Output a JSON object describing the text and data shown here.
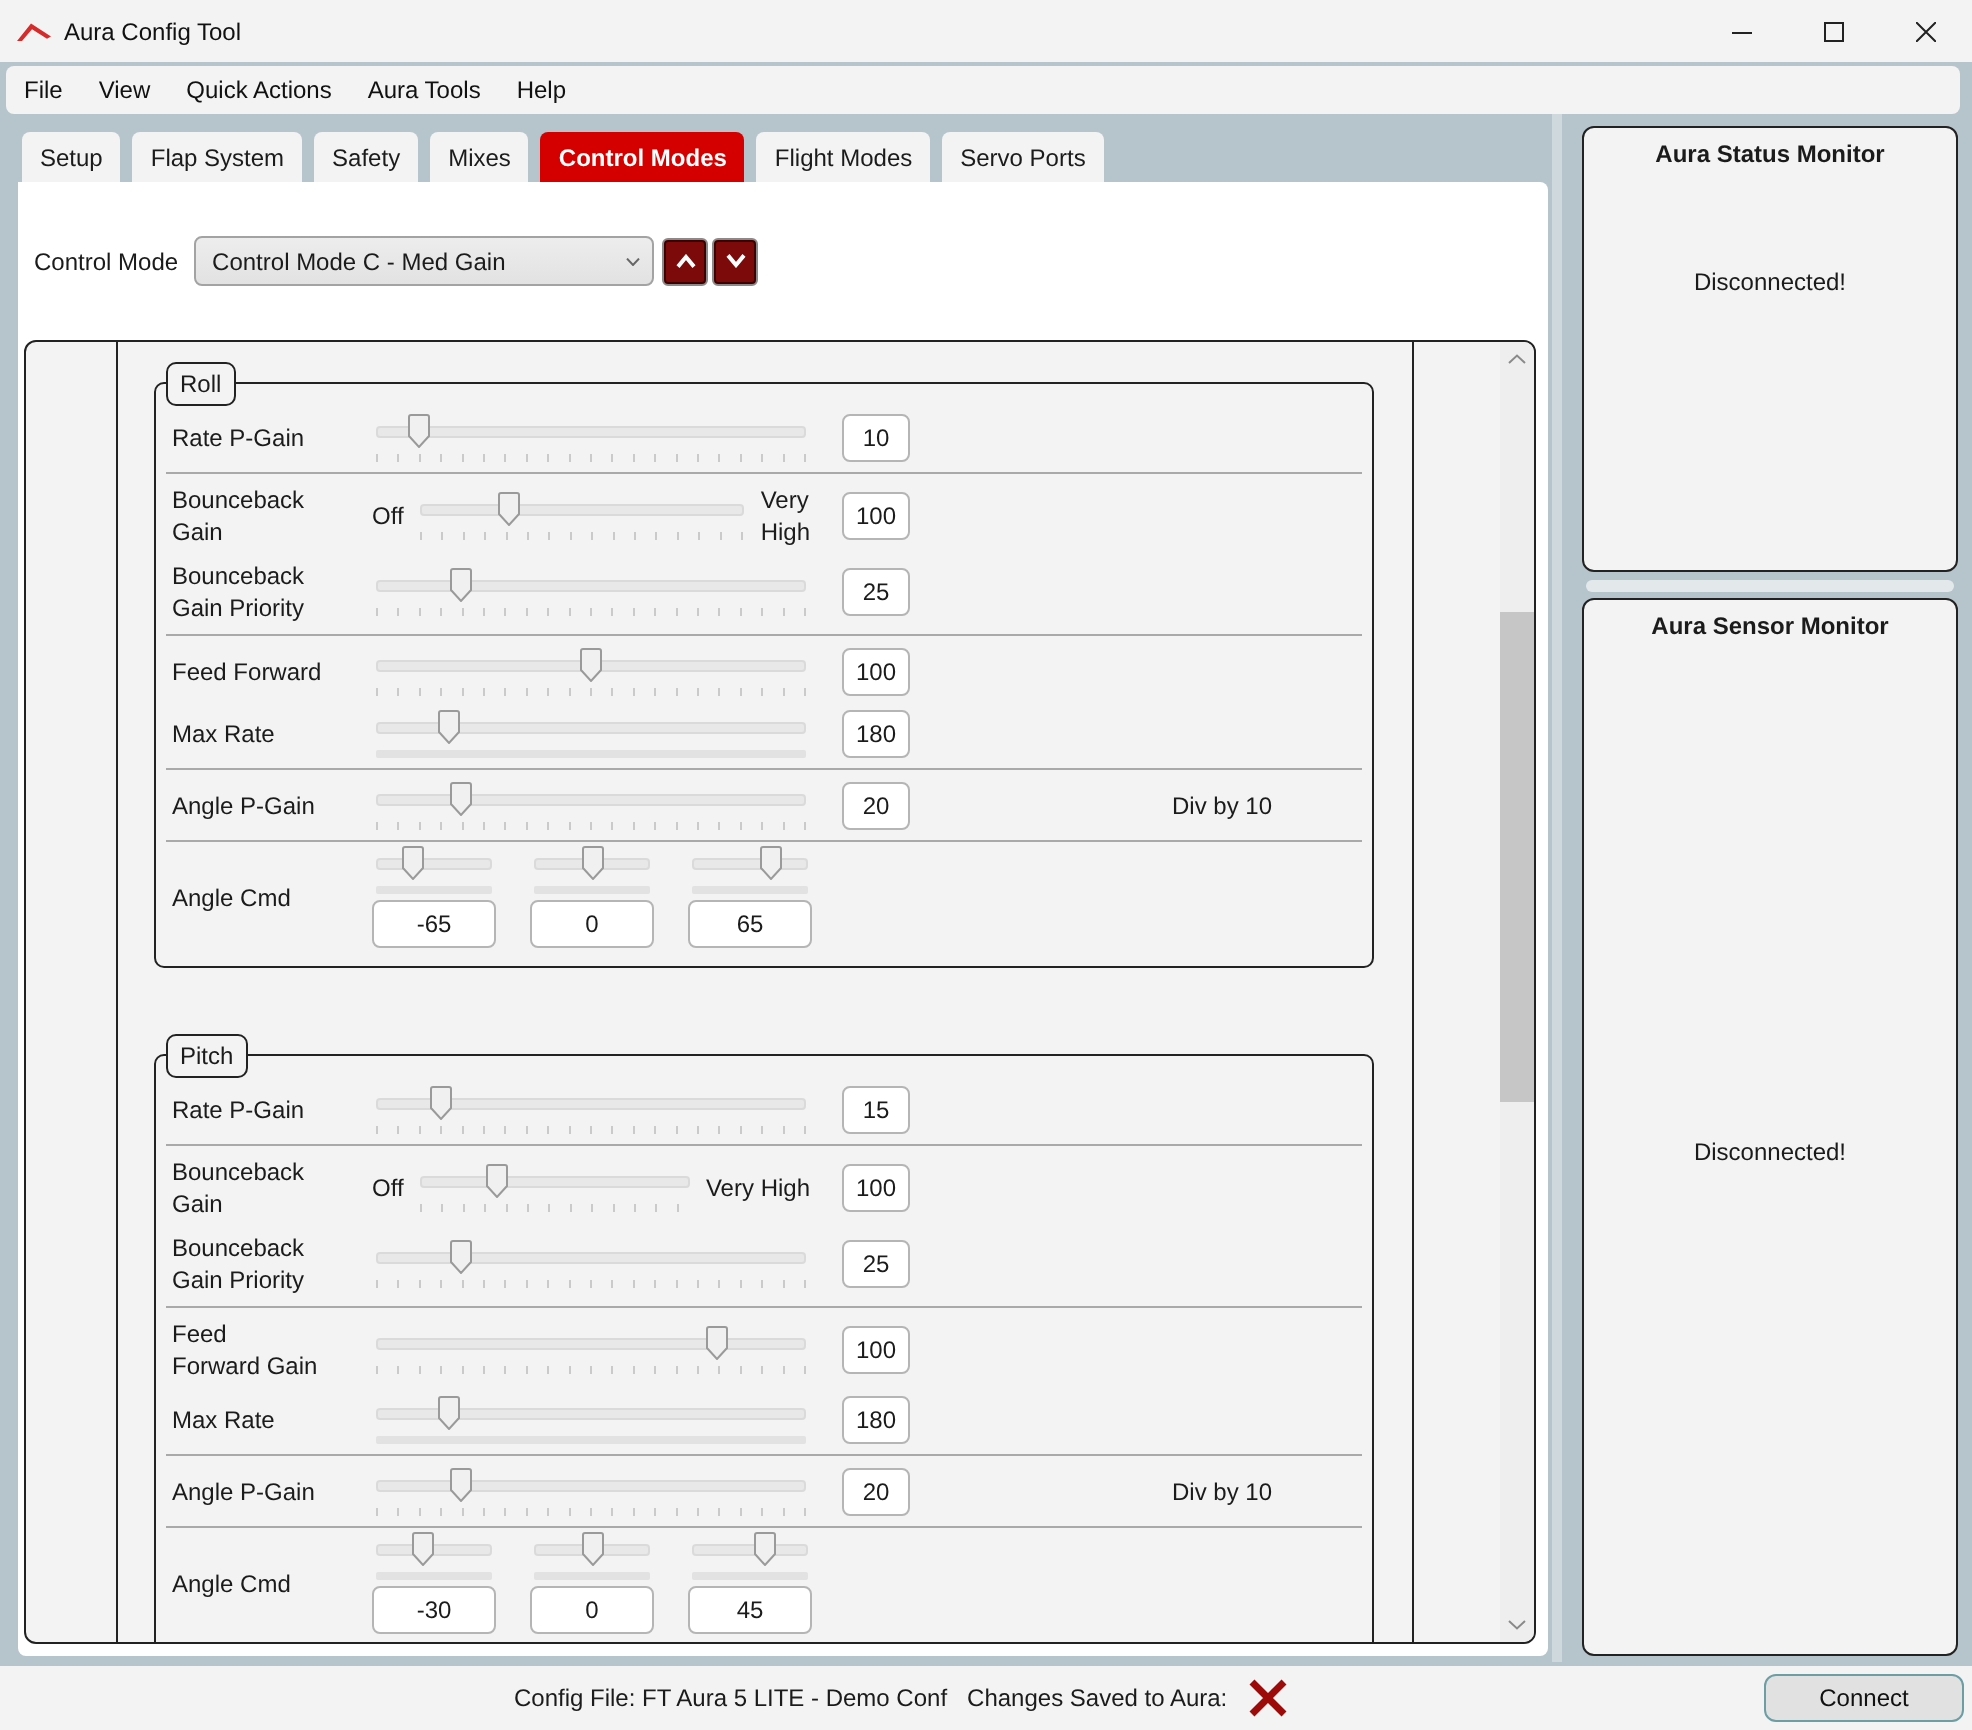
{
  "window": {
    "title": "Aura Config Tool"
  },
  "menu": [
    "File",
    "View",
    "Quick Actions",
    "Aura Tools",
    "Help"
  ],
  "tabs": [
    {
      "label": "Setup",
      "selected": false
    },
    {
      "label": "Flap System",
      "selected": false
    },
    {
      "label": "Safety",
      "selected": false
    },
    {
      "label": "Mixes",
      "selected": false
    },
    {
      "label": "Control Modes",
      "selected": true
    },
    {
      "label": "Flight Modes",
      "selected": false
    },
    {
      "label": "Servo Ports",
      "selected": false
    }
  ],
  "control_mode": {
    "label": "Control Mode",
    "value": "Control Mode C - Med Gain"
  },
  "groups": [
    {
      "title": "Roll",
      "sections": [
        [
          {
            "kind": "slider",
            "label": "Rate P-Gain",
            "level": 0.08,
            "value": "10"
          }
        ],
        [
          {
            "kind": "range",
            "label": "Bounceback\nGain",
            "low": "Off",
            "high": "Very\nHigh",
            "level": 0.26,
            "value": "100"
          },
          {
            "kind": "slider",
            "label": "Bounceback\nGain Priority",
            "level": 0.18,
            "value": "25"
          }
        ],
        [
          {
            "kind": "slider",
            "label": "Feed Forward",
            "level": 0.5,
            "value": "100"
          },
          {
            "kind": "bar_slider",
            "label": "Max Rate",
            "level": 0.15,
            "value": "180"
          }
        ],
        [
          {
            "kind": "slider",
            "label": "Angle P-Gain",
            "level": 0.18,
            "value": "20",
            "note": "Div by 10"
          }
        ],
        [
          {
            "kind": "triple",
            "label": "Angle Cmd",
            "sliders": [
              {
                "level": 0.27,
                "value": "-65"
              },
              {
                "level": 0.5,
                "value": "0"
              },
              {
                "level": 0.72,
                "value": "65"
              }
            ]
          }
        ]
      ]
    },
    {
      "title": "Pitch",
      "sections": [
        [
          {
            "kind": "slider",
            "label": "Rate P-Gain",
            "level": 0.13,
            "value": "15"
          }
        ],
        [
          {
            "kind": "range",
            "label": "Bounceback\nGain",
            "low": "Off",
            "high": "Very High",
            "level": 0.27,
            "value": "100"
          },
          {
            "kind": "slider",
            "label": "Bounceback\nGain Priority",
            "level": 0.18,
            "value": "25"
          }
        ],
        [
          {
            "kind": "slider",
            "label": "Feed\nForward Gain",
            "level": 0.81,
            "value": "100"
          },
          {
            "kind": "bar_slider",
            "label": "Max Rate",
            "level": 0.15,
            "value": "180"
          }
        ],
        [
          {
            "kind": "slider",
            "label": "Angle P-Gain",
            "level": 0.18,
            "value": "20",
            "note": "Div by 10"
          }
        ],
        [
          {
            "kind": "triple",
            "label": "Angle Cmd",
            "sliders": [
              {
                "level": 0.39,
                "value": "-30"
              },
              {
                "level": 0.5,
                "value": "0"
              },
              {
                "level": 0.65,
                "value": "45"
              }
            ]
          }
        ]
      ]
    }
  ],
  "monitors": [
    {
      "title": "Aura Status Monitor",
      "message": "Disconnected!"
    },
    {
      "title": "Aura Sensor Monitor",
      "message": "Disconnected!"
    }
  ],
  "status_bar": {
    "config_file": "Config File: FT Aura 5 LITE - Demo Conf",
    "changes_label": "Changes Saved to Aura:",
    "changes_saved": false,
    "connect": "Connect"
  }
}
